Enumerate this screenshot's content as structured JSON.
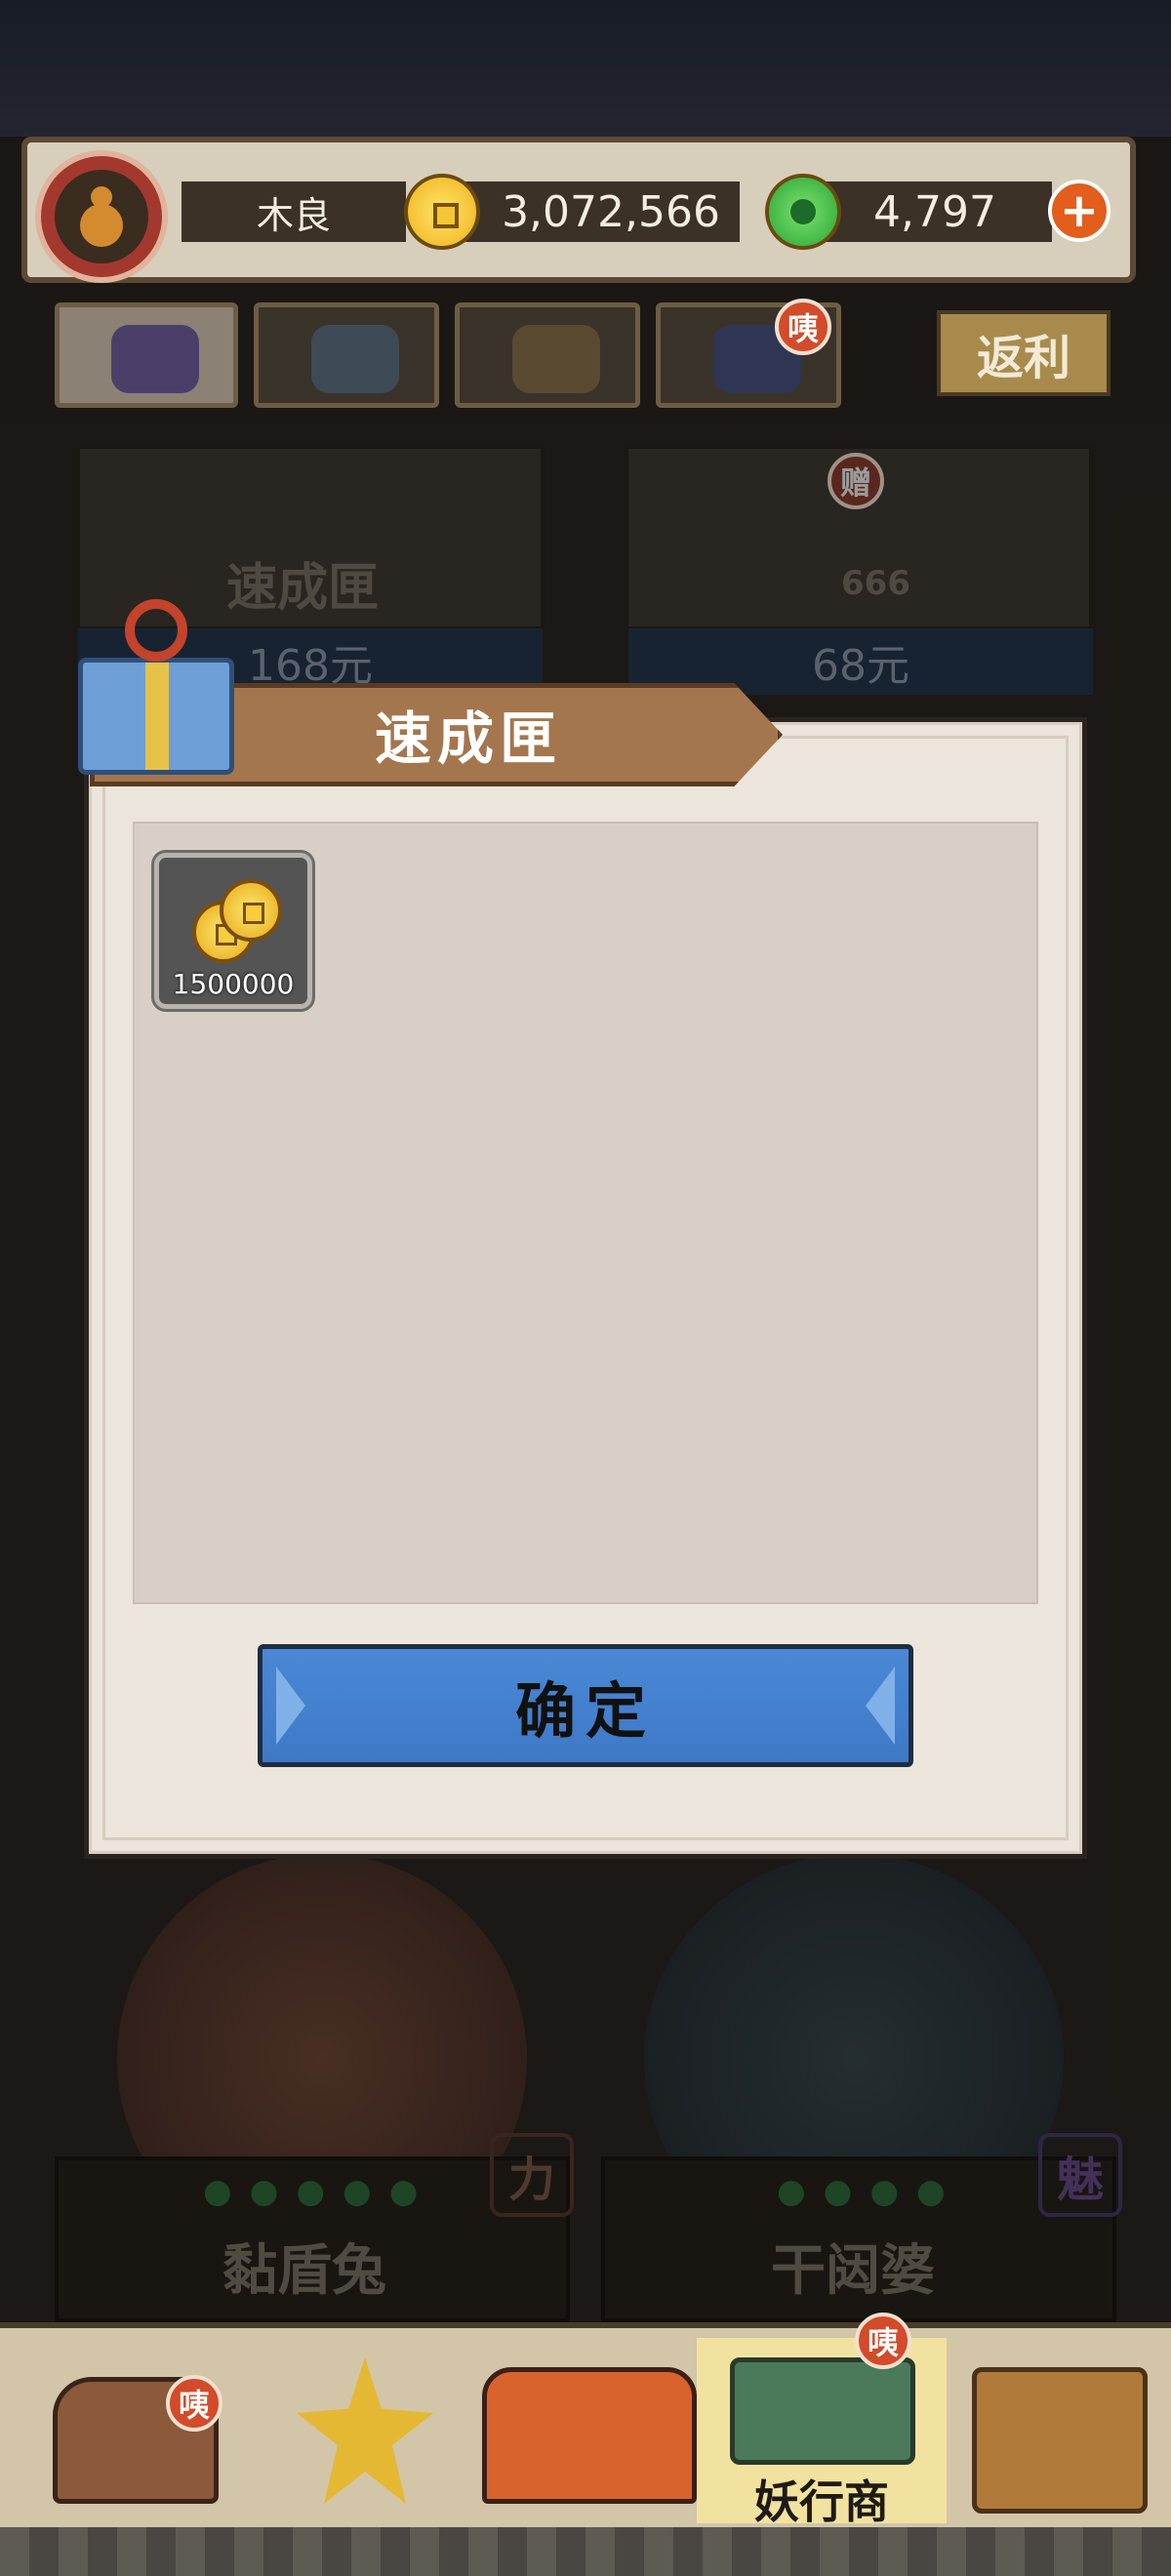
{
  "player": {
    "name": "木良",
    "gold": "3,072,566",
    "gems": "4,797"
  },
  "tabs": [
    {
      "name": "tab-monster"
    },
    {
      "name": "tab-eye"
    },
    {
      "name": "tab-basket"
    },
    {
      "name": "tab-moon"
    }
  ],
  "tab_badge": "咦",
  "rebate_label": "返利",
  "shop_cards": [
    {
      "title": "速成匣",
      "price": "168元"
    },
    {
      "title": "",
      "count": "666",
      "gift_badge": "赠",
      "price": "68元"
    }
  ],
  "characters": [
    {
      "name": "黏盾兔",
      "trait": "力"
    },
    {
      "name": "干闼婆",
      "trait": "魅"
    }
  ],
  "dialog": {
    "title": "速成匣",
    "items": [
      {
        "icon": "gold-coins-icon",
        "count": "1500000"
      }
    ],
    "confirm_label": "确定"
  },
  "bottom_nav": {
    "items": [
      {
        "name": "nav-treasure-chest",
        "badge": "咦"
      },
      {
        "name": "nav-star-trophy"
      },
      {
        "name": "nav-yao-gate"
      },
      {
        "name": "nav-yao-merchant",
        "label": "妖行商",
        "badge": "咦"
      },
      {
        "name": "nav-compass-book"
      }
    ]
  },
  "colors": {
    "accent_blue": "#4a88d6",
    "ribbon_brown": "#a4764e",
    "badge_red": "#d24b2a"
  }
}
